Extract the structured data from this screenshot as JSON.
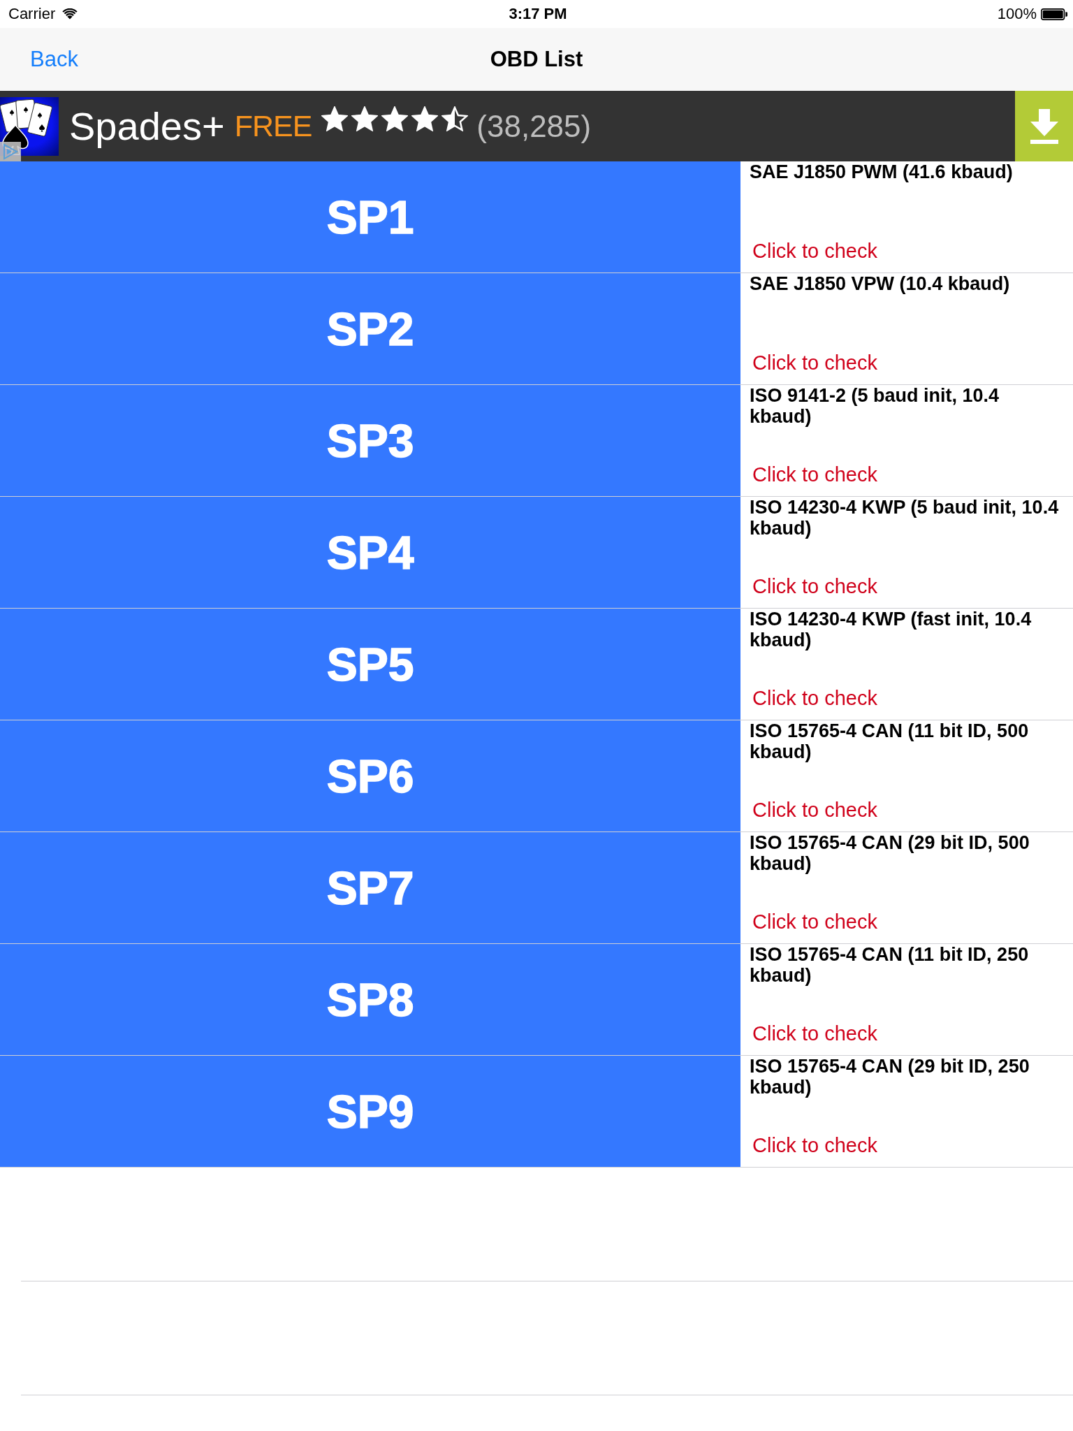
{
  "status_bar": {
    "carrier": "Carrier",
    "time": "3:17 PM",
    "battery": "100%"
  },
  "nav_bar": {
    "back": "Back",
    "title": "OBD List"
  },
  "ad_banner": {
    "app_name": "Spades+",
    "price": "FREE",
    "stars": 4.5,
    "rating_count": "(38,285)"
  },
  "protocols": [
    {
      "code": "SP1",
      "name": "SAE J1850 PWM (41.6 kbaud)",
      "action": "Click to check"
    },
    {
      "code": "SP2",
      "name": "SAE J1850 VPW (10.4 kbaud)",
      "action": "Click to check"
    },
    {
      "code": "SP3",
      "name": "ISO 9141-2 (5 baud init, 10.4 kbaud)",
      "action": "Click to check"
    },
    {
      "code": "SP4",
      "name": "ISO 14230-4 KWP (5 baud init, 10.4 kbaud)",
      "action": "Click to check"
    },
    {
      "code": "SP5",
      "name": "ISO 14230-4 KWP (fast init, 10.4 kbaud)",
      "action": "Click to check"
    },
    {
      "code": "SP6",
      "name": "ISO 15765-4 CAN (11 bit ID, 500 kbaud)",
      "action": "Click to check"
    },
    {
      "code": "SP7",
      "name": "ISO 15765-4 CAN (29 bit ID, 500 kbaud)",
      "action": "Click to check"
    },
    {
      "code": "SP8",
      "name": "ISO 15765-4 CAN (11 bit ID, 250 kbaud)",
      "action": "Click to check"
    },
    {
      "code": "SP9",
      "name": "ISO 15765-4 CAN (29 bit ID, 250 kbaud)",
      "action": "Click to check"
    }
  ]
}
